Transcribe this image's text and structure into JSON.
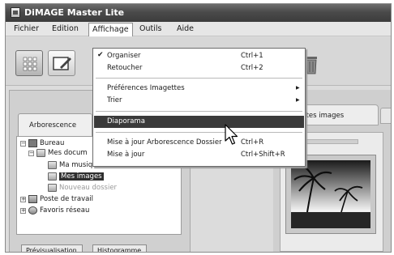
{
  "window": {
    "title": "DiMAGE Master Lite"
  },
  "menubar": [
    "Fichier",
    "Edition",
    "Affichage",
    "Outils",
    "Aide"
  ],
  "dropdown": {
    "items": [
      {
        "label": "Organiser",
        "shortcut": "Ctrl+1",
        "checked": true
      },
      {
        "label": "Retoucher",
        "shortcut": "Ctrl+2"
      },
      {
        "label": "Préférences Imagettes",
        "submenu": true
      },
      {
        "label": "Trier",
        "submenu": true
      },
      {
        "label": "Diaporama",
        "highlighted": true
      },
      {
        "label": "Mise à jour Arborescence Dossier",
        "shortcut": "Ctrl+R"
      },
      {
        "label": "Mise à jour",
        "shortcut": "Ctrl+Shift+R"
      }
    ]
  },
  "left_pane": {
    "tab": "Arborescence",
    "tree": [
      {
        "label": "Bureau",
        "icon": "desktop-icon"
      },
      {
        "label": "Mes docum",
        "icon": "folder-icon"
      },
      {
        "label": "Ma musique",
        "icon": "folder-icon"
      },
      {
        "label": "Mes images",
        "icon": "folder-icon",
        "selected": true
      },
      {
        "label": "Nouveau dossier",
        "icon": "folder-icon"
      },
      {
        "label": "Poste de travail",
        "icon": "computer-icon"
      },
      {
        "label": "Favoris réseau",
        "icon": "network-icon"
      }
    ],
    "bottom_tabs": [
      "Prévisualisation",
      "Histogramme"
    ]
  },
  "right_pane": {
    "tab": "outes images"
  },
  "colors": {
    "menu_highlight": "#3a3a3a",
    "titlebar": "#4a4a4a"
  }
}
